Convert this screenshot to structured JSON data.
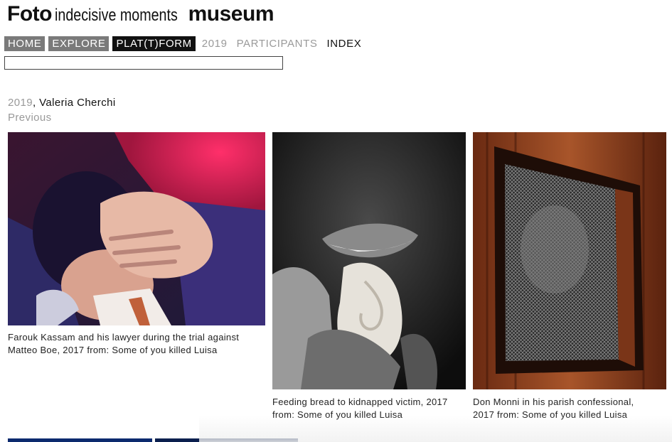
{
  "site": {
    "title_bold_1": "Foto",
    "title_middle": "indecisive moments",
    "title_bold_2": "museum"
  },
  "nav": {
    "home": "HOME",
    "explore": "EXPLORE",
    "platform": "PLAT(T)FORM",
    "year": "2019",
    "participants": "PARTICIPANTS",
    "index": "INDEX"
  },
  "search": {
    "value": "",
    "placeholder": ""
  },
  "breadcrumb": {
    "year": "2019",
    "separator": ",",
    "artist": "Valeria Cherchi"
  },
  "pager": {
    "previous": "Previous"
  },
  "photos": [
    {
      "caption_line1": "Farouk Kassam and his lawyer during the trial against",
      "caption_line2": "Matteo Boe, 2017 from: Some of you killed Luisa"
    },
    {
      "caption_line1": "Feeding bread to kidnapped victim, 2017",
      "caption_line2": "from: Some of you killed Luisa"
    },
    {
      "caption_line1": "Don Monni in his parish confessional,",
      "caption_line2": "2017 from: Some of you killed Luisa"
    }
  ],
  "colors": {
    "nav_grey": "#7a7a7a",
    "nav_black": "#111111",
    "muted_text": "#999999"
  }
}
